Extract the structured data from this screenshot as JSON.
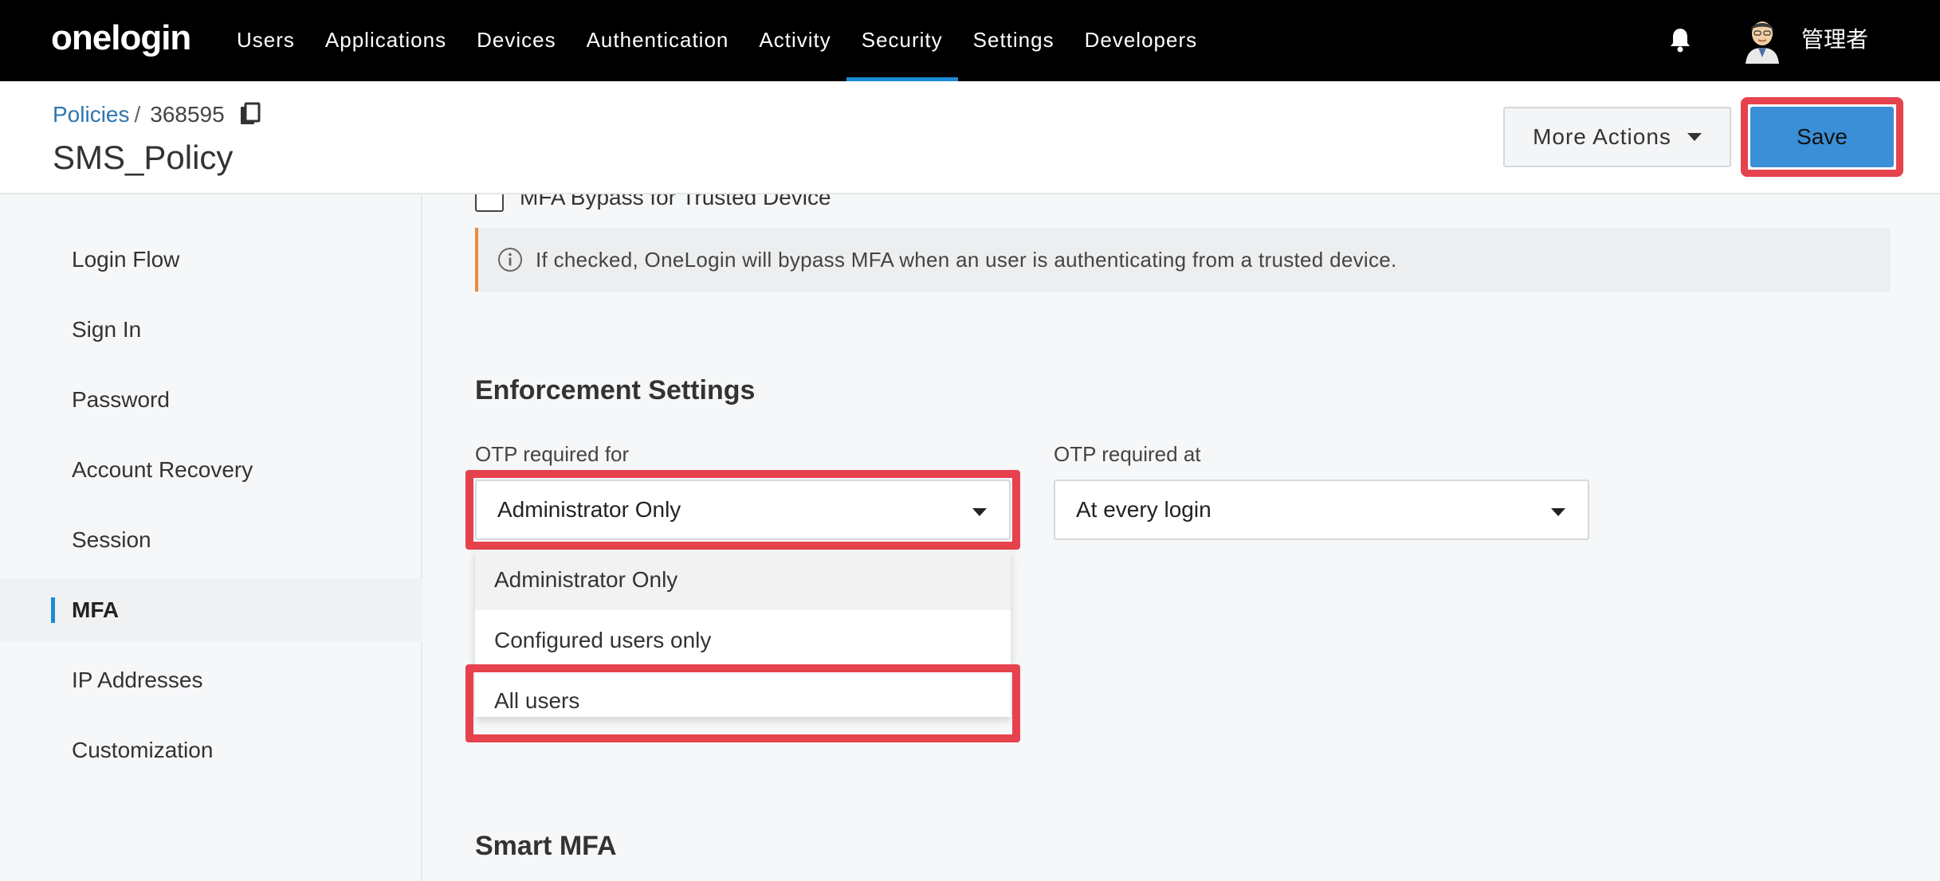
{
  "topbar": {
    "logo": "onelogin",
    "nav": [
      {
        "label": "Users",
        "active": false
      },
      {
        "label": "Applications",
        "active": false
      },
      {
        "label": "Devices",
        "active": false
      },
      {
        "label": "Authentication",
        "active": false
      },
      {
        "label": "Activity",
        "active": false
      },
      {
        "label": "Security",
        "active": true
      },
      {
        "label": "Settings",
        "active": false
      },
      {
        "label": "Developers",
        "active": false
      }
    ],
    "username": "管理者"
  },
  "header": {
    "breadcrumb_link": "Policies",
    "breadcrumb_sep": "/",
    "policy_id": "368595",
    "title": "SMS_Policy",
    "more_actions_label": "More Actions",
    "save_label": "Save"
  },
  "sidebar": {
    "items": [
      {
        "label": "Login Flow",
        "active": false
      },
      {
        "label": "Sign In",
        "active": false
      },
      {
        "label": "Password",
        "active": false
      },
      {
        "label": "Account Recovery",
        "active": false
      },
      {
        "label": "Session",
        "active": false
      },
      {
        "label": "MFA",
        "active": true
      },
      {
        "label": "IP Addresses",
        "active": false
      },
      {
        "label": "Customization",
        "active": false
      }
    ]
  },
  "main": {
    "bypass_checkbox_label": "MFA Bypass for Trusted Device",
    "bypass_checked": false,
    "info_text": "If checked, OneLogin will bypass MFA when an user is authenticating from a trusted device.",
    "enforcement_title": "Enforcement Settings",
    "otp_for_label": "OTP required for",
    "otp_for_value": "Administrator Only",
    "otp_at_label": "OTP required at",
    "otp_at_value": "At every login",
    "otp_for_options": [
      "Administrator Only",
      "Configured users only",
      "All users"
    ],
    "smart_mfa_title": "Smart MFA"
  },
  "colors": {
    "accent": "#1c8bd5",
    "save_button": "#3b8fd6",
    "highlight": "#e5424d",
    "info_border": "#ec8a3b"
  }
}
